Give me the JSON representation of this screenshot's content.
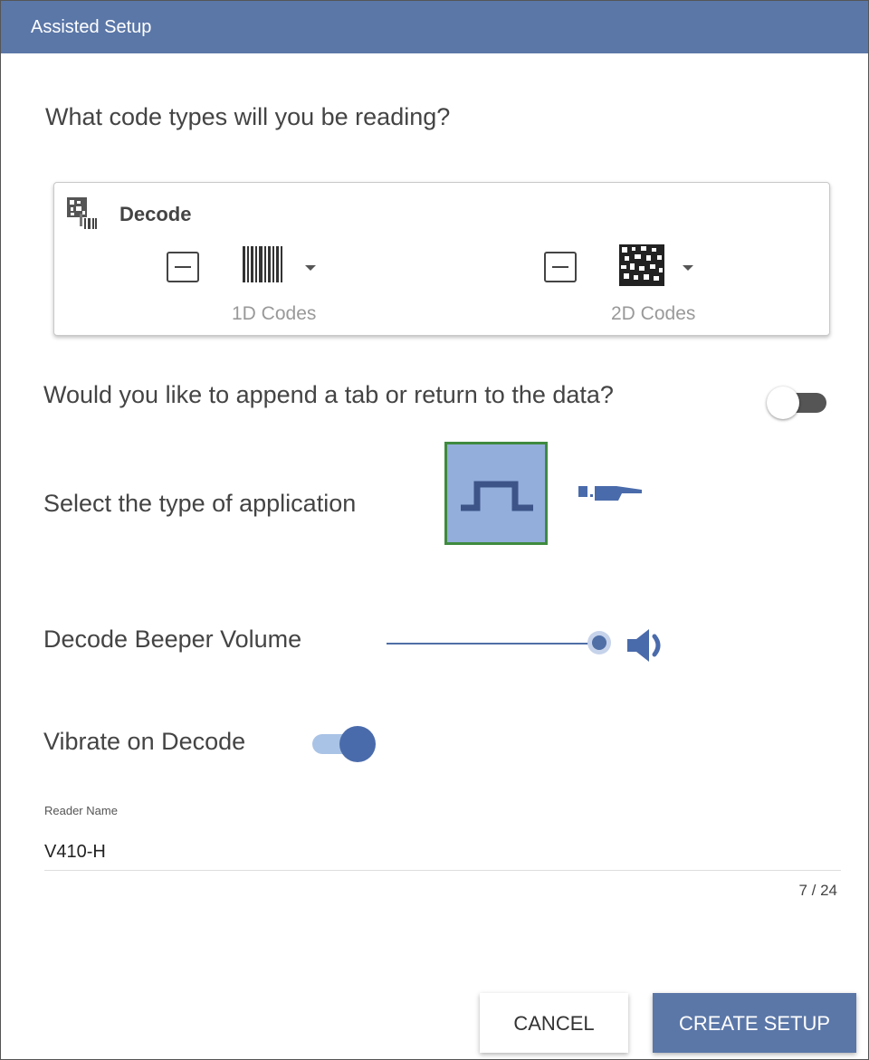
{
  "window": {
    "title": "Assisted Setup"
  },
  "questions": {
    "code_types": "What code types will you be reading?",
    "append": "Would you like to append a tab or return to the data?",
    "application": "Select the type of application",
    "volume": "Decode Beeper Volume",
    "vibrate": "Vibrate on Decode"
  },
  "decode": {
    "title": "Decode",
    "codes": [
      {
        "label": "1D Codes",
        "icon": "barcode-1d-icon"
      },
      {
        "label": "2D Codes",
        "icon": "barcode-2d-icon"
      }
    ]
  },
  "append_toggle": {
    "on": false
  },
  "application": {
    "options": [
      {
        "icon": "pulse-trigger-icon",
        "selected": true
      },
      {
        "icon": "hand-held-icon",
        "selected": false
      }
    ]
  },
  "volume": {
    "level": 1.0,
    "icon": "speaker-icon"
  },
  "vibrate_toggle": {
    "on": true
  },
  "reader_name": {
    "label": "Reader Name",
    "value": "V410-H",
    "counter": "7 / 24"
  },
  "buttons": {
    "cancel": "CANCEL",
    "create": "CREATE SETUP"
  },
  "colors": {
    "accent": "#5b77a8",
    "selected_border": "#3f8a3f",
    "selected_fill": "#93aedb"
  }
}
